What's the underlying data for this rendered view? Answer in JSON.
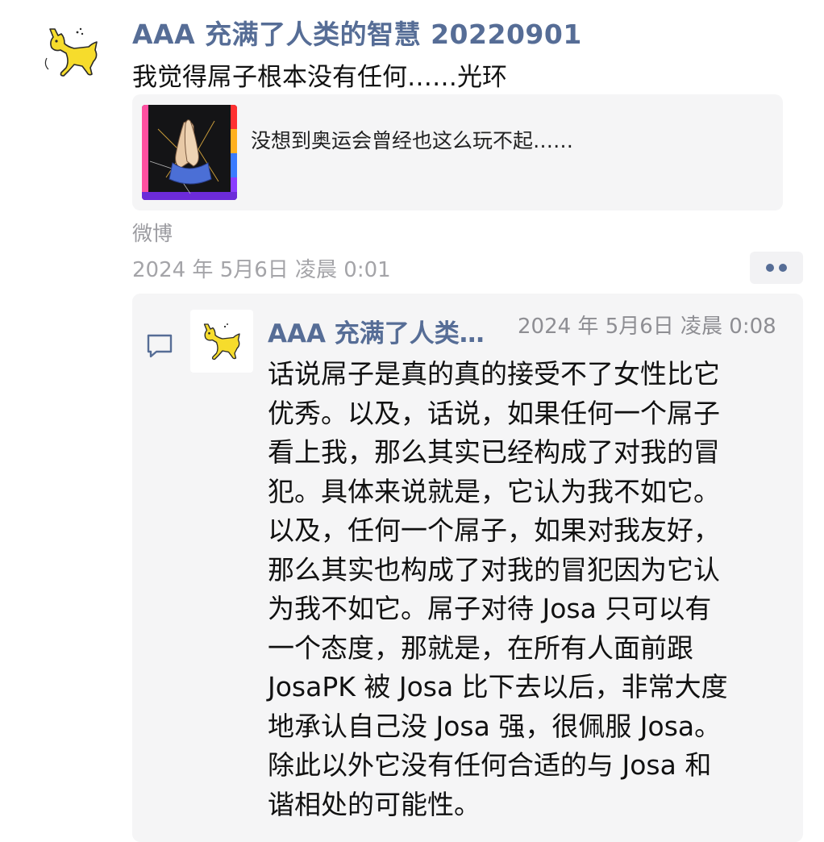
{
  "post": {
    "author": "AAA 充满了人类的智慧 20220901",
    "text": "我觉得屌子根本没有任何……光环",
    "link_card": {
      "title": "没想到奥运会曾经也这么玩不起……",
      "thumbnail_icon": "praying-hands-icon"
    },
    "source": "微博",
    "timestamp": "2024 年 5月6日 凌晨 0:01",
    "more_icon": "more-dots-icon"
  },
  "comment": {
    "icon": "comment-bubble-icon",
    "author": "AAA 充满了人类…",
    "timestamp": "2024 年 5月6日 凌晨 0:08",
    "text": "话说屌子是真的真的接受不了女性比它\n优秀。以及，话说，如果任何一个屌子\n看上我，那么其实已经构成了对我的冒\n犯。具体来说就是，它认为我不如它。\n以及，任何一个屌子，如果对我友好，\n那么其实也构成了对我的冒犯因为它认\n为我不如它。屌子对待 Josa 只可以有\n一个态度，那就是，在所有人面前跟\nJosaPK 被 Josa 比下去以后，非常大度\n地承认自己没 Josa 强，很佩服 Josa。\n除此以外它没有任何合适的与 Josa 和\n谐相处的可能性。"
  },
  "colors": {
    "link_blue": "#566d96",
    "card_background": "#f5f5f6",
    "meta_gray": "#a4a4a8",
    "avatar_yellow": "#f6dc2c"
  }
}
